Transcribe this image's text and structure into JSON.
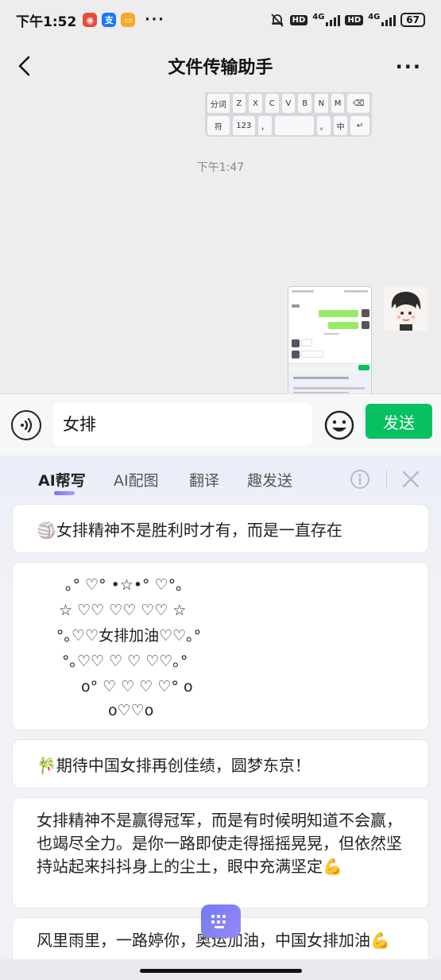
{
  "status_bar": {
    "time": "下午1:52",
    "app_icons": [
      "netease-music-icon",
      "alipay-icon",
      "message-icon"
    ],
    "more": "···",
    "network_left": "4G",
    "network_right": "4G",
    "hd": "HD",
    "battery": "67"
  },
  "nav": {
    "title": "文件传输助手",
    "more": "···"
  },
  "chat": {
    "keyboard_snippet": {
      "row1": [
        "分词",
        "Z",
        "X",
        "C",
        "V",
        "B",
        "N",
        "M",
        "⌫"
      ],
      "row2": [
        "符",
        "123",
        "，",
        "",
        "。",
        "中",
        "↵"
      ]
    },
    "timestamp": "下午1:47"
  },
  "input": {
    "value": "女排",
    "send_label": "发送"
  },
  "ai_panel": {
    "tabs": [
      {
        "label": "AI帮写",
        "active": true
      },
      {
        "label": "AI配图",
        "active": false
      },
      {
        "label": "翻译",
        "active": false
      },
      {
        "label": "趣发送",
        "active": false
      }
    ],
    "suggestions": [
      {
        "text": "🏐女排精神不是胜利时才有，而是一直存在"
      },
      {
        "art_lines": [
          "｡° ♡° •☆•° ♡°｡",
          "☆ ♡♡ ♡♡ ♡♡ ☆",
          "°｡♡♡女排加油♡♡｡°",
          "°｡♡♡ ♡ ♡ ♡♡｡°",
          "o° ♡ ♡ ♡ ♡° o",
          "o♡♡o"
        ]
      },
      {
        "text": "🎋期待中国女排再创佳绩，圆梦东京！"
      },
      {
        "text": "女排精神不是赢得冠军，而是有时候明知道不会赢，也竭尽全力。是你一路即使走得摇摇晃晃，但依然坚持站起来抖抖身上的尘土，眼中充满坚定💪"
      },
      {
        "text": "风里雨里，一路婷你，奥运加油，中国女排加油💪"
      }
    ]
  },
  "colors": {
    "accent_green": "#07c160",
    "ai_purple": "#7b6cf6"
  }
}
